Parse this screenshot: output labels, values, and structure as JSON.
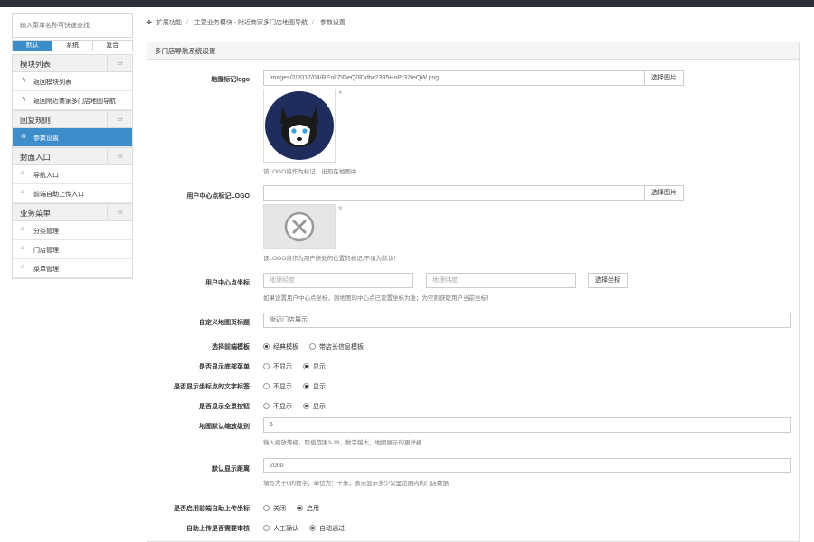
{
  "sidebar": {
    "search_placeholder": "输入菜单名称可快速查找",
    "tabs": [
      "默认",
      "系统",
      "复合"
    ],
    "groups": [
      {
        "title": "模块列表",
        "items": [
          {
            "icon": "return-icon",
            "glyph": "↰",
            "label": "返回模块列表"
          },
          {
            "icon": "return-icon",
            "glyph": "↰",
            "label": "返回附近商家多门店地图导航"
          }
        ]
      },
      {
        "title": "回复规则",
        "items": [
          {
            "icon": "gear-icon",
            "glyph": "⚙",
            "label": "参数设置",
            "active": true
          }
        ]
      },
      {
        "title": "封面入口",
        "items": [
          {
            "icon": "entry-icon",
            "glyph": "⌂",
            "label": "导航入口"
          },
          {
            "icon": "entry-icon",
            "glyph": "⌂",
            "label": "前端自助上传入口"
          }
        ]
      },
      {
        "title": "业务菜单",
        "items": [
          {
            "icon": "entry-icon",
            "glyph": "⌂",
            "label": "分类管理"
          },
          {
            "icon": "entry-icon",
            "glyph": "⌂",
            "label": "门店管理"
          },
          {
            "icon": "entry-icon",
            "glyph": "⌂",
            "label": "菜单管理"
          }
        ]
      }
    ],
    "toggle_glyph": "⊖"
  },
  "breadcrumb": {
    "icon": "puzzle-icon",
    "items": [
      "扩展功能",
      "主要业务模块 - 附近商家多门店地图导航",
      "参数设置"
    ]
  },
  "panel": {
    "title": "多门店导航系统设置",
    "map_logo": {
      "label": "地图标记logo",
      "value": "images/2/2017/04/REnltZIDeQ0lDdtw2335HnPr32teQW.png",
      "button": "选择图片",
      "help": "该LOGO将作为标记，出现在地图中"
    },
    "center_logo": {
      "label": "用户中心点标记LOGO",
      "value": "",
      "button": "选择图片",
      "help": "该LOGO将作为用户所处的位置的标记,不填为默认！"
    },
    "center_coord": {
      "label": "用户中心点坐标",
      "lng_placeholder": "地理经度",
      "lat_placeholder": "地理纬度",
      "button": "选择坐标",
      "help": "如果设置用户中心点坐标，则地图的中心点已设置坐标为准；为空则获取用户当前坐标！"
    },
    "custom_title": {
      "label": "自定义地图页标题",
      "value": "附近门店展示"
    },
    "template": {
      "label": "选择前端模板",
      "options": [
        "经典模板",
        "带店长信息模板"
      ],
      "selected": 0
    },
    "show_bottom_menu": {
      "label": "是否显示底部菜单",
      "options": [
        "不显示",
        "显示"
      ],
      "selected": 1
    },
    "show_marker_label": {
      "label": "是否显示坐标点的文字标签",
      "options": [
        "不显示",
        "显示"
      ],
      "selected": 1
    },
    "show_fullscreen": {
      "label": "是否显示全景按钮",
      "options": [
        "不显示",
        "显示"
      ],
      "selected": 1
    },
    "zoom": {
      "label": "地图默认缩放级别",
      "value": "6",
      "help": "输入缩放等级，取值范围3-19，数字越大，地图展示的更详细"
    },
    "distance": {
      "label": "默认显示距离",
      "value": "2000",
      "help": "填写大于0的数字，单位为：千米，表示显示多少公里范围内的门店数据"
    },
    "self_upload": {
      "label": "是否启用前端自助上传坐标",
      "options": [
        "关闭",
        "启用"
      ],
      "selected": 1
    },
    "upload_review": {
      "label": "自助上传是否需要审核",
      "options": [
        "人工确认",
        "自动通过"
      ],
      "selected": 1
    }
  }
}
